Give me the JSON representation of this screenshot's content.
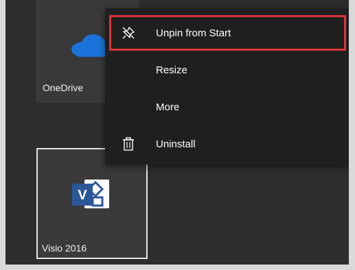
{
  "tiles": [
    {
      "label": "OneDrive",
      "icon": "onedrive-cloud-icon",
      "accent": "#1a73d9"
    },
    {
      "label": "Visio 2016",
      "icon": "visio-icon",
      "accent": "#2b579a"
    }
  ],
  "context_menu": {
    "items": [
      {
        "label": "Unpin from Start",
        "icon": "unpin-icon",
        "highlighted": true
      },
      {
        "label": "Resize",
        "icon": ""
      },
      {
        "label": "More",
        "icon": ""
      },
      {
        "label": "Uninstall",
        "icon": "trash-icon"
      }
    ],
    "highlight_color": "#e0353b"
  }
}
